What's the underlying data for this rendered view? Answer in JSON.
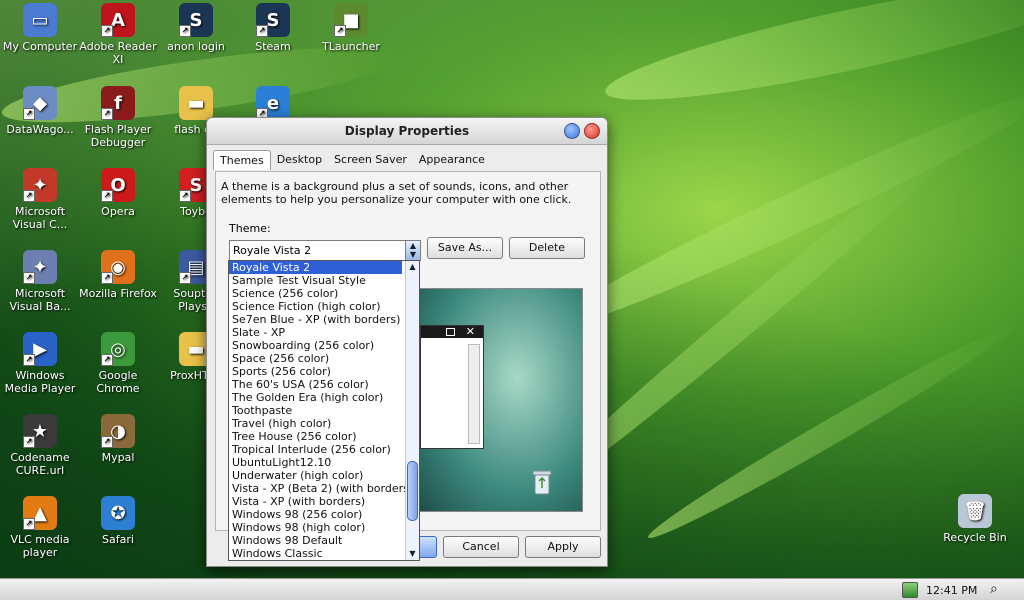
{
  "desktop": {
    "icons": [
      {
        "label": "My Computer",
        "icon": "computer-icon",
        "color": "#4a7bd0",
        "glyph": "▭"
      },
      {
        "label": "Adobe Reader XI",
        "icon": "adobe-reader-icon",
        "color": "#c0141c",
        "glyph": "A"
      },
      {
        "label": "anon login",
        "icon": "steam-icon",
        "color": "#1b3554",
        "glyph": "S"
      },
      {
        "label": "Steam",
        "icon": "steam-icon",
        "color": "#1b3554",
        "glyph": "S"
      },
      {
        "label": "TLauncher",
        "icon": "minecraft-block-icon",
        "color": "#5d8a2f",
        "glyph": "■"
      },
      {
        "label": "DataWago...",
        "icon": "datawago-icon",
        "color": "#6c8cc4",
        "glyph": "◆"
      },
      {
        "label": "Flash Player Debugger",
        "icon": "flash-icon",
        "color": "#8b1a1a",
        "glyph": "f"
      },
      {
        "label": "flash ga",
        "icon": "folder-icon",
        "color": "#e8c14a",
        "glyph": "▬"
      },
      {
        "label": "",
        "icon": "internet-explorer-icon",
        "color": "#2b7fd6",
        "glyph": "e"
      },
      {
        "label": "Microsoft Visual C...",
        "icon": "visual-c-icon",
        "color": "#c43a2a",
        "glyph": "✦"
      },
      {
        "label": "Opera",
        "icon": "opera-icon",
        "color": "#cc1a1a",
        "glyph": "O"
      },
      {
        "label": "Toybo",
        "icon": "toybox-icon",
        "color": "#d21f1f",
        "glyph": "S"
      },
      {
        "label": "Microsoft Visual Ba...",
        "icon": "visual-basic-icon",
        "color": "#6b7fb0",
        "glyph": "✦"
      },
      {
        "label": "Mozilla Firefox",
        "icon": "firefox-icon",
        "color": "#e0701c",
        "glyph": "◉"
      },
      {
        "label": "Souptoy Playse",
        "icon": "souptoy-icon",
        "color": "#3c5aa0",
        "glyph": "▤"
      },
      {
        "label": "Windows Media Player",
        "icon": "media-player-icon",
        "color": "#2a63c7",
        "glyph": "▶"
      },
      {
        "label": "Google Chrome",
        "icon": "chrome-icon",
        "color": "#3b9a3b",
        "glyph": "◎"
      },
      {
        "label": "ProxHTTP",
        "icon": "folder-icon",
        "color": "#e8c14a",
        "glyph": "▬"
      },
      {
        "label": "Codename CURE.url",
        "icon": "codename-cure-icon",
        "color": "#3a3a3a",
        "glyph": "★"
      },
      {
        "label": "Mypal",
        "icon": "mypal-icon",
        "color": "#8a6a3a",
        "glyph": "◑"
      },
      {
        "label": "VLC media player",
        "icon": "vlc-icon",
        "color": "#e37b14",
        "glyph": "▲"
      },
      {
        "label": "Safari",
        "icon": "safari-icon",
        "color": "#2d7fd3",
        "glyph": "✪"
      },
      {
        "label": "Recycle Bin",
        "icon": "recycle-bin-icon",
        "color": "#b9c7d6",
        "glyph": "🗑"
      }
    ]
  },
  "window": {
    "title": "Display Properties",
    "tabs": [
      {
        "label": "Themes",
        "active": true
      },
      {
        "label": "Desktop",
        "active": false
      },
      {
        "label": "Screen Saver",
        "active": false
      },
      {
        "label": "Appearance",
        "active": false
      }
    ],
    "description": "A theme is a background plus a set of sounds, icons, and other elements to help you personalize your computer with one click.",
    "theme_label": "Theme:",
    "theme_value": "Royale Vista 2",
    "save_as_label": "Save As...",
    "delete_label": "Delete",
    "cancel_label": "Cancel",
    "apply_label": "Apply",
    "options": [
      "Royale Vista 2",
      "Sample Test Visual Style",
      "Science (256 color)",
      "Science Fiction (high color)",
      "Se7en Blue - XP (with borders)",
      "Slate - XP",
      "Snowboarding (256 color)",
      "Space (256 color)",
      "Sports (256 color)",
      "The 60's USA (256 color)",
      "The Golden Era (high color)",
      "Toothpaste",
      "Travel (high color)",
      "Tree House (256 color)",
      "Tropical Interlude (256 color)",
      "UbuntuLight12.10",
      "Underwater (high color)",
      "Vista - XP (Beta 2) (with borders)",
      "Vista - XP (with borders)",
      "Windows 98 (256 color)",
      "Windows 98 (high color)",
      "Windows 98 Default",
      "Windows Classic"
    ],
    "selected_index": 0
  },
  "taskbar": {
    "time": "12:41 PM"
  },
  "colors": {
    "selection": "#2e5fd6",
    "close_button": "#d8322b",
    "help_button": "#3a78d8"
  }
}
